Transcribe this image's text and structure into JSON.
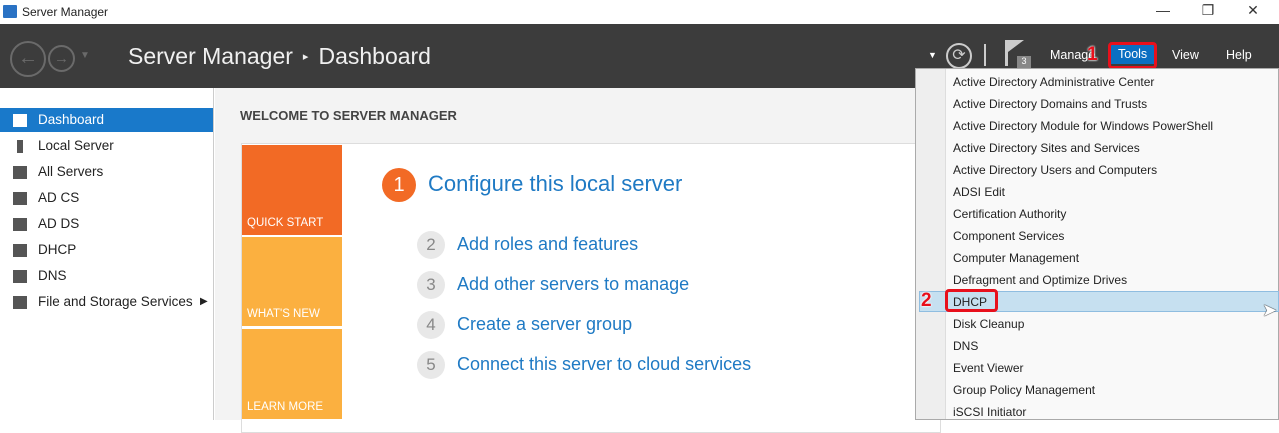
{
  "window": {
    "title": "Server Manager",
    "minimize": "—",
    "maximize": "❐",
    "close": "✕"
  },
  "header": {
    "app": "Server Manager",
    "page": "Dashboard",
    "separator": "▸",
    "flag_count": "3",
    "menu": [
      {
        "label": "Manage"
      },
      {
        "label": "Tools"
      },
      {
        "label": "View"
      },
      {
        "label": "Help"
      }
    ]
  },
  "sidebar": {
    "items": [
      {
        "label": "Dashboard"
      },
      {
        "label": "Local Server"
      },
      {
        "label": "All Servers"
      },
      {
        "label": "AD CS"
      },
      {
        "label": "AD DS"
      },
      {
        "label": "DHCP"
      },
      {
        "label": "DNS"
      },
      {
        "label": "File and Storage Services"
      }
    ]
  },
  "main": {
    "welcome": "WELCOME TO SERVER MANAGER",
    "tiles": [
      {
        "label": "QUICK START",
        "color": "#f26a25"
      },
      {
        "label": "WHAT'S NEW",
        "color": "#fbb040"
      },
      {
        "label": "LEARN MORE",
        "color": "#fbb040"
      }
    ],
    "steps": [
      {
        "n": "1",
        "label": "Configure this local server"
      },
      {
        "n": "2",
        "label": "Add roles and features"
      },
      {
        "n": "3",
        "label": "Add other servers to manage"
      },
      {
        "n": "4",
        "label": "Create a server group"
      },
      {
        "n": "5",
        "label": "Connect this server to cloud services"
      }
    ]
  },
  "tools_menu": {
    "items": [
      {
        "label": "Active Directory Administrative Center"
      },
      {
        "label": "Active Directory Domains and Trusts"
      },
      {
        "label": "Active Directory Module for Windows PowerShell"
      },
      {
        "label": "Active Directory Sites and Services"
      },
      {
        "label": "Active Directory Users and Computers"
      },
      {
        "label": "ADSI Edit"
      },
      {
        "label": "Certification Authority"
      },
      {
        "label": "Component Services"
      },
      {
        "label": "Computer Management"
      },
      {
        "label": "Defragment and Optimize Drives"
      },
      {
        "label": "DHCP"
      },
      {
        "label": "Disk Cleanup"
      },
      {
        "label": "DNS"
      },
      {
        "label": "Event Viewer"
      },
      {
        "label": "Group Policy Management"
      },
      {
        "label": "iSCSI Initiator"
      }
    ]
  },
  "annotations": {
    "a1": "1",
    "a2": "2"
  }
}
